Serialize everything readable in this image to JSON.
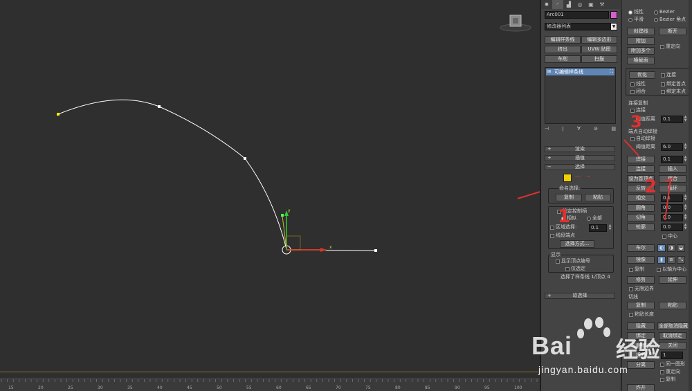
{
  "colors": {
    "viewport_bg": "#2f2f2f",
    "panel_bg": "#444444",
    "spline": "#ffffff",
    "highlight": "#5f86b6",
    "annotation": "#e03030",
    "object_color": "#d55fd0"
  },
  "viewport": {
    "axis_x": "x",
    "axis_y": "y"
  },
  "ruler": {
    "ticks": [
      "15",
      "20",
      "25",
      "30",
      "35",
      "40",
      "45",
      "50",
      "55",
      "60",
      "65",
      "70",
      "75",
      "80",
      "85",
      "90",
      "95",
      "100"
    ]
  },
  "command_panel": {
    "tabs": [
      "create-icon",
      "modify-icon",
      "hierarchy-icon",
      "motion-icon",
      "display-icon",
      "utilities-icon"
    ],
    "object_name": "Arc001",
    "modifier_list": "修改器列表",
    "buttons": {
      "edit_spline": "编辑样条线",
      "edit_poly": "编辑多边形",
      "extrude": "挤出",
      "uvw_map": "UVW 贴图",
      "lathe": "车削",
      "sweep": "扫描"
    },
    "stack_item": "可编辑样条线",
    "rollouts": {
      "render": "渲染",
      "interpolation": "插值",
      "selection": "选择",
      "soft_selection": "软选择"
    },
    "selection": {
      "named_sel": "命名选择:",
      "copy": "复制",
      "paste": "粘贴",
      "lock_handles": "锁定控制柄",
      "alike": "相似",
      "all": "全部",
      "area_select": "区域选择:",
      "area_value": "0.1",
      "segment_end": "线段端点",
      "select_by": "选择方式...",
      "display": "显示",
      "show_vertex_numbers": "显示顶点编号",
      "selected_only": "仅选定",
      "status": "选择了样条线 1/顶点 4"
    }
  },
  "right_panel": {
    "linear": "线性",
    "bezier": "Bezier",
    "smooth": "平滑",
    "bezier_corner": "Bezier 角点",
    "create_line": "创建线",
    "break": "断开",
    "attach": "附加",
    "reorient": "重定向",
    "attach_mult": "附加多个",
    "cross_section": "横截面",
    "refine": "优化",
    "connect": "连接",
    "linear2": "线性",
    "bind_first": "绑定首点",
    "closed": "闭合",
    "bind_last": "绑定末点",
    "connect_copy": "连接复制",
    "connect2": "连接",
    "threshold": "阈值距离",
    "threshold_value": "0.1",
    "end_auto_weld": "端点自动焊接",
    "auto_weld": "自动焊接",
    "threshold2": "阈值距离",
    "threshold2_value": "6.0",
    "weld": "焊接",
    "weld_value": "0.1",
    "connect3": "连接",
    "insert": "插入",
    "make_first": "设为首顶点",
    "fuse": "熔合",
    "reverse": "反转",
    "cycle": "循环",
    "cross_insert": "相交",
    "cross_value": "0.1",
    "fillet": "圆角",
    "fillet_value": "0.0",
    "chamfer": "切角",
    "chamfer_value": "0.0",
    "outline": "轮廓",
    "outline_value": "0.0",
    "center": "中心",
    "boolean": "布尔",
    "mirror": "镜像",
    "copy2": "复制",
    "about_pivot": "以轴为中心",
    "trim": "修剪",
    "extend": "延伸",
    "infinite_bounds": "无限边界",
    "tangent": "切线",
    "copy3": "复制",
    "paste2": "粘贴",
    "paste_length": "粘贴长度",
    "hide": "隐藏",
    "unhide_all": "全部取消隐藏",
    "bind": "绑定",
    "unbind": "取消绑定",
    "delete": "删除",
    "close": "关闭",
    "divide": "拆分",
    "divide_value": "1",
    "detach": "分离",
    "same_shape": "同一图形",
    "reorient2": "重定向",
    "copy4": "复制",
    "explode": "炸开"
  },
  "annotations": {
    "one": "1",
    "two": "2",
    "three": "3"
  },
  "watermark": {
    "brand": "Bai",
    "brand_cn": "经验",
    "url": "jingyan.baidu.com"
  }
}
